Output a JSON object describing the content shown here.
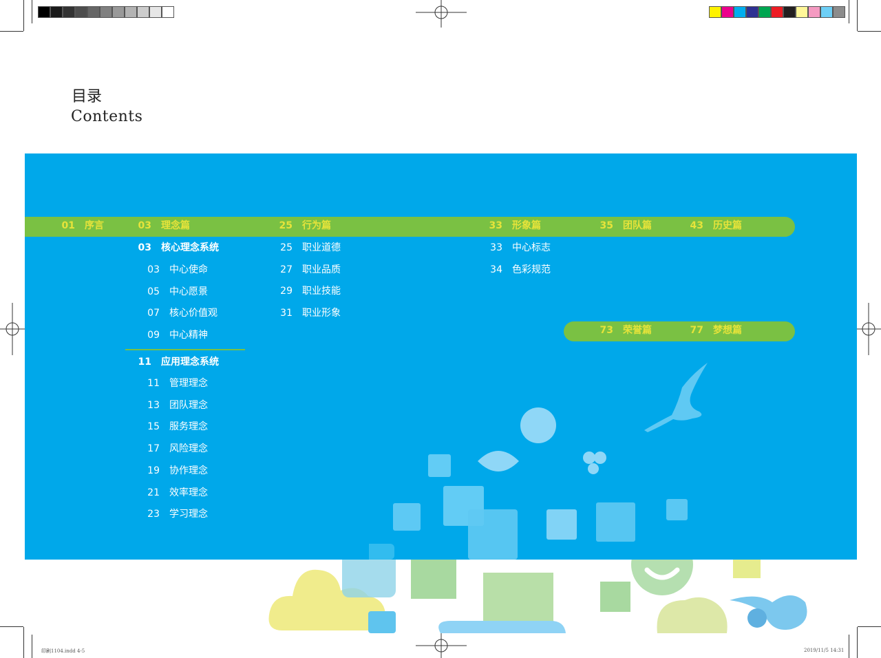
{
  "heading": {
    "title_cn": "目录",
    "title_en": "Contents"
  },
  "color_bar_left": [
    "#000000",
    "#1a1a1a",
    "#333333",
    "#4d4d4d",
    "#666666",
    "#808080",
    "#999999",
    "#b3b3b3",
    "#cccccc",
    "#e6e6e6",
    "#ffffff"
  ],
  "color_bar_right": [
    "#fff200",
    "#ec008c",
    "#00aeef",
    "#2e3192",
    "#00a651",
    "#ed1c24",
    "#231f20",
    "#fff799",
    "#f49ac1",
    "#6dcff6",
    "#8c8c8c"
  ],
  "colors": {
    "panel_blue": "#00a8ea",
    "bar_green": "#7ac143",
    "highlight_yellow": "#e6e33a"
  },
  "top_bar": [
    {
      "page": "01",
      "label": "序言"
    },
    {
      "page": "03",
      "label": "理念篇"
    },
    {
      "page": "25",
      "label": "行为篇"
    },
    {
      "page": "33",
      "label": "形象篇"
    },
    {
      "page": "35",
      "label": "团队篇"
    },
    {
      "page": "43",
      "label": "历史篇"
    }
  ],
  "lower_bar": [
    {
      "page": "73",
      "label": "荣誉篇"
    },
    {
      "page": "77",
      "label": "梦想篇"
    }
  ],
  "col_idea": {
    "group1": {
      "page": "03",
      "label": "核心理念系统"
    },
    "group1_items": [
      {
        "page": "03",
        "label": "中心使命"
      },
      {
        "page": "05",
        "label": "中心愿景"
      },
      {
        "page": "07",
        "label": "核心价值观"
      },
      {
        "page": "09",
        "label": "中心精神"
      }
    ],
    "group2": {
      "page": "11",
      "label": "应用理念系统"
    },
    "group2_items": [
      {
        "page": "11",
        "label": "管理理念"
      },
      {
        "page": "13",
        "label": "团队理念"
      },
      {
        "page": "15",
        "label": "服务理念"
      },
      {
        "page": "17",
        "label": "风险理念"
      },
      {
        "page": "19",
        "label": "协作理念"
      },
      {
        "page": "21",
        "label": "效率理念"
      },
      {
        "page": "23",
        "label": "学习理念"
      }
    ]
  },
  "col_behavior": [
    {
      "page": "25",
      "label": "职业道德"
    },
    {
      "page": "27",
      "label": "职业品质"
    },
    {
      "page": "29",
      "label": "职业技能"
    },
    {
      "page": "31",
      "label": "职业形象"
    }
  ],
  "col_image": [
    {
      "page": "33",
      "label": "中心标志"
    },
    {
      "page": "34",
      "label": "色彩规范"
    }
  ],
  "footer": {
    "left": "印刷1104.indd   4-5",
    "right": "2019/11/5   14:31"
  },
  "icons": [
    "registration-mark-icon",
    "eagle-icon",
    "cloud-icon",
    "smiley-icon",
    "leaf-icon",
    "clover-icon"
  ]
}
